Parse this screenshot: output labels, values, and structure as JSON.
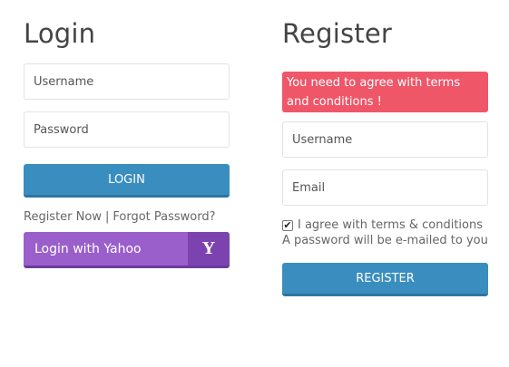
{
  "login": {
    "title": "Login",
    "username_placeholder": "Username",
    "password_placeholder": "Password",
    "button_label": "LOGIN",
    "register_link": "Register Now",
    "separator": "|",
    "forgot_link": "Forgot Password?",
    "yahoo_label": "Login with Yahoo",
    "yahoo_logo": "Y"
  },
  "register": {
    "title": "Register",
    "alert": "You need to agree with terms and conditions !",
    "username_placeholder": "Username",
    "email_placeholder": "Email",
    "agree_label": "I agree with terms & conditions",
    "agree_checked": true,
    "note": "A password will be e-mailed to you",
    "button_label": "REGISTER"
  },
  "colors": {
    "button_blue": "#3a8ebf",
    "alert_red": "#ef5668",
    "yahoo_purple": "#9a5fcb",
    "yahoo_dark_purple": "#7c43b0"
  },
  "icons": {
    "yahoo": "yahoo-logo-icon",
    "checkbox": "check-icon"
  }
}
